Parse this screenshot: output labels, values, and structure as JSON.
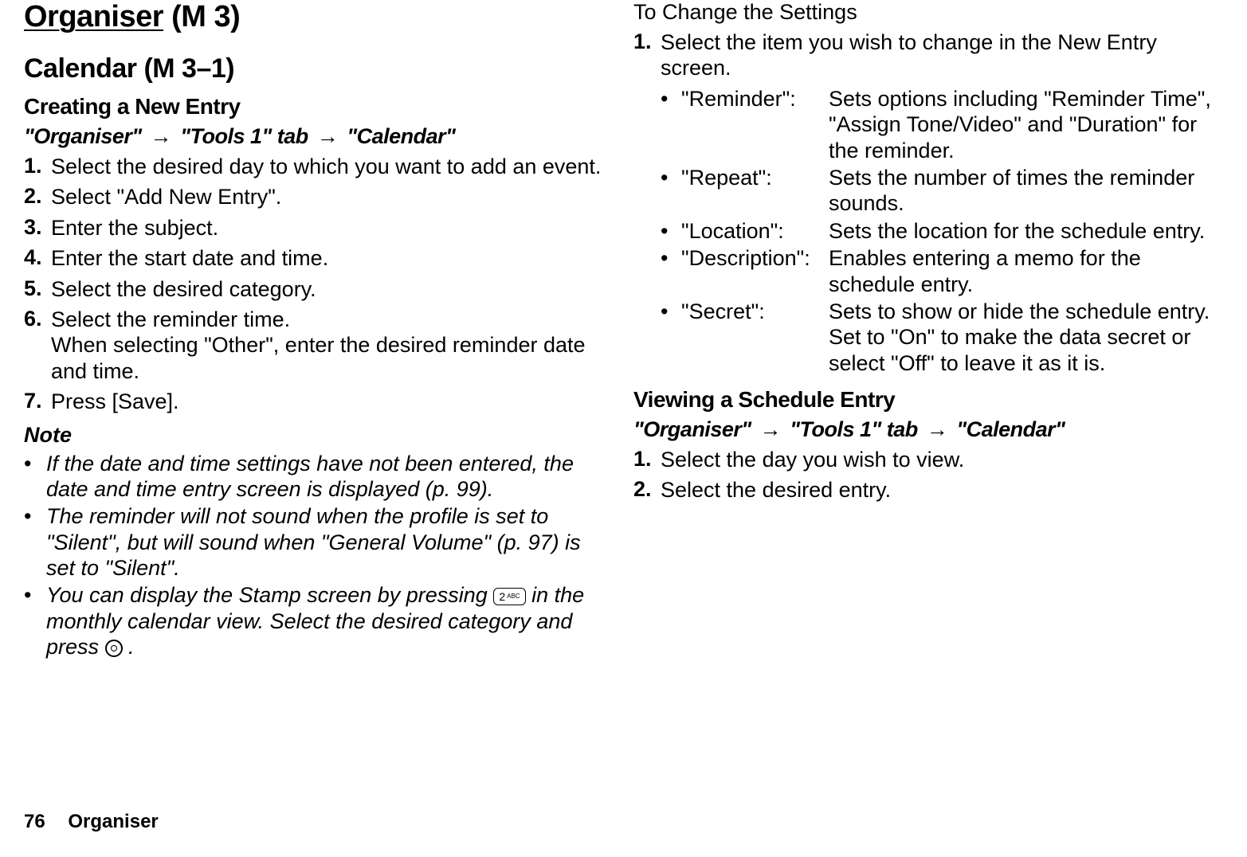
{
  "page_number": "76",
  "footer_section": "Organiser",
  "left": {
    "h1_underlined": "Organiser",
    "h1_suffix": " (M 3)",
    "h2": "Calendar (M 3–1)",
    "subheading": "Creating a New Entry",
    "nav": {
      "p1": "\"Organiser\"",
      "p2": "\"Tools 1\" tab",
      "p3": "\"Calendar\""
    },
    "steps": [
      "Select the desired day to which you want to add an event.",
      "Select \"Add New Entry\".",
      "Enter the subject.",
      "Enter the start date and time.",
      "Select the desired category.",
      "Select the reminder time.",
      "Press [Save]."
    ],
    "step6_sub": "When selecting \"Other\", enter the desired reminder date and time.",
    "note_label": "Note",
    "notes": [
      "If the date and time settings have not been entered, the date and time entry screen is displayed (p. 99).",
      "The reminder will not sound when the profile is set to \"Silent\", but will sound when \"General Volume\" (p. 97) is set to \"Silent\"."
    ],
    "note3_pre": "You can display the Stamp screen by pressing ",
    "note3_mid": " in the monthly calendar view. Select the desired category and press ",
    "note3_post": "."
  },
  "right": {
    "heading": "To Change the Settings",
    "step1": "Select the item you wish to change in the New Entry screen.",
    "settings": [
      {
        "key": "\"Reminder\":",
        "desc": "Sets options including \"Reminder Time\", \"Assign Tone/Video\" and \"Duration\" for the reminder."
      },
      {
        "key": "\"Repeat\":",
        "desc": "Sets the number of times the reminder sounds."
      },
      {
        "key": "\"Location\":",
        "desc": "Sets the location for the schedule entry."
      },
      {
        "key": "\"Description\":",
        "desc": "Enables entering a memo for the schedule entry."
      },
      {
        "key": "\"Secret\":",
        "desc": "Sets to show or hide the schedule entry. Set to \"On\" to make the data secret or select \"Off\" to leave it as it is."
      }
    ],
    "subheading2": "Viewing a Schedule Entry",
    "nav2": {
      "p1": "\"Organiser\"",
      "p2": "\"Tools 1\" tab",
      "p3": "\"Calendar\""
    },
    "view_steps": [
      "Select the day you wish to view.",
      "Select the desired entry."
    ]
  },
  "icons": {
    "key_pill_label": "2 ABC"
  }
}
